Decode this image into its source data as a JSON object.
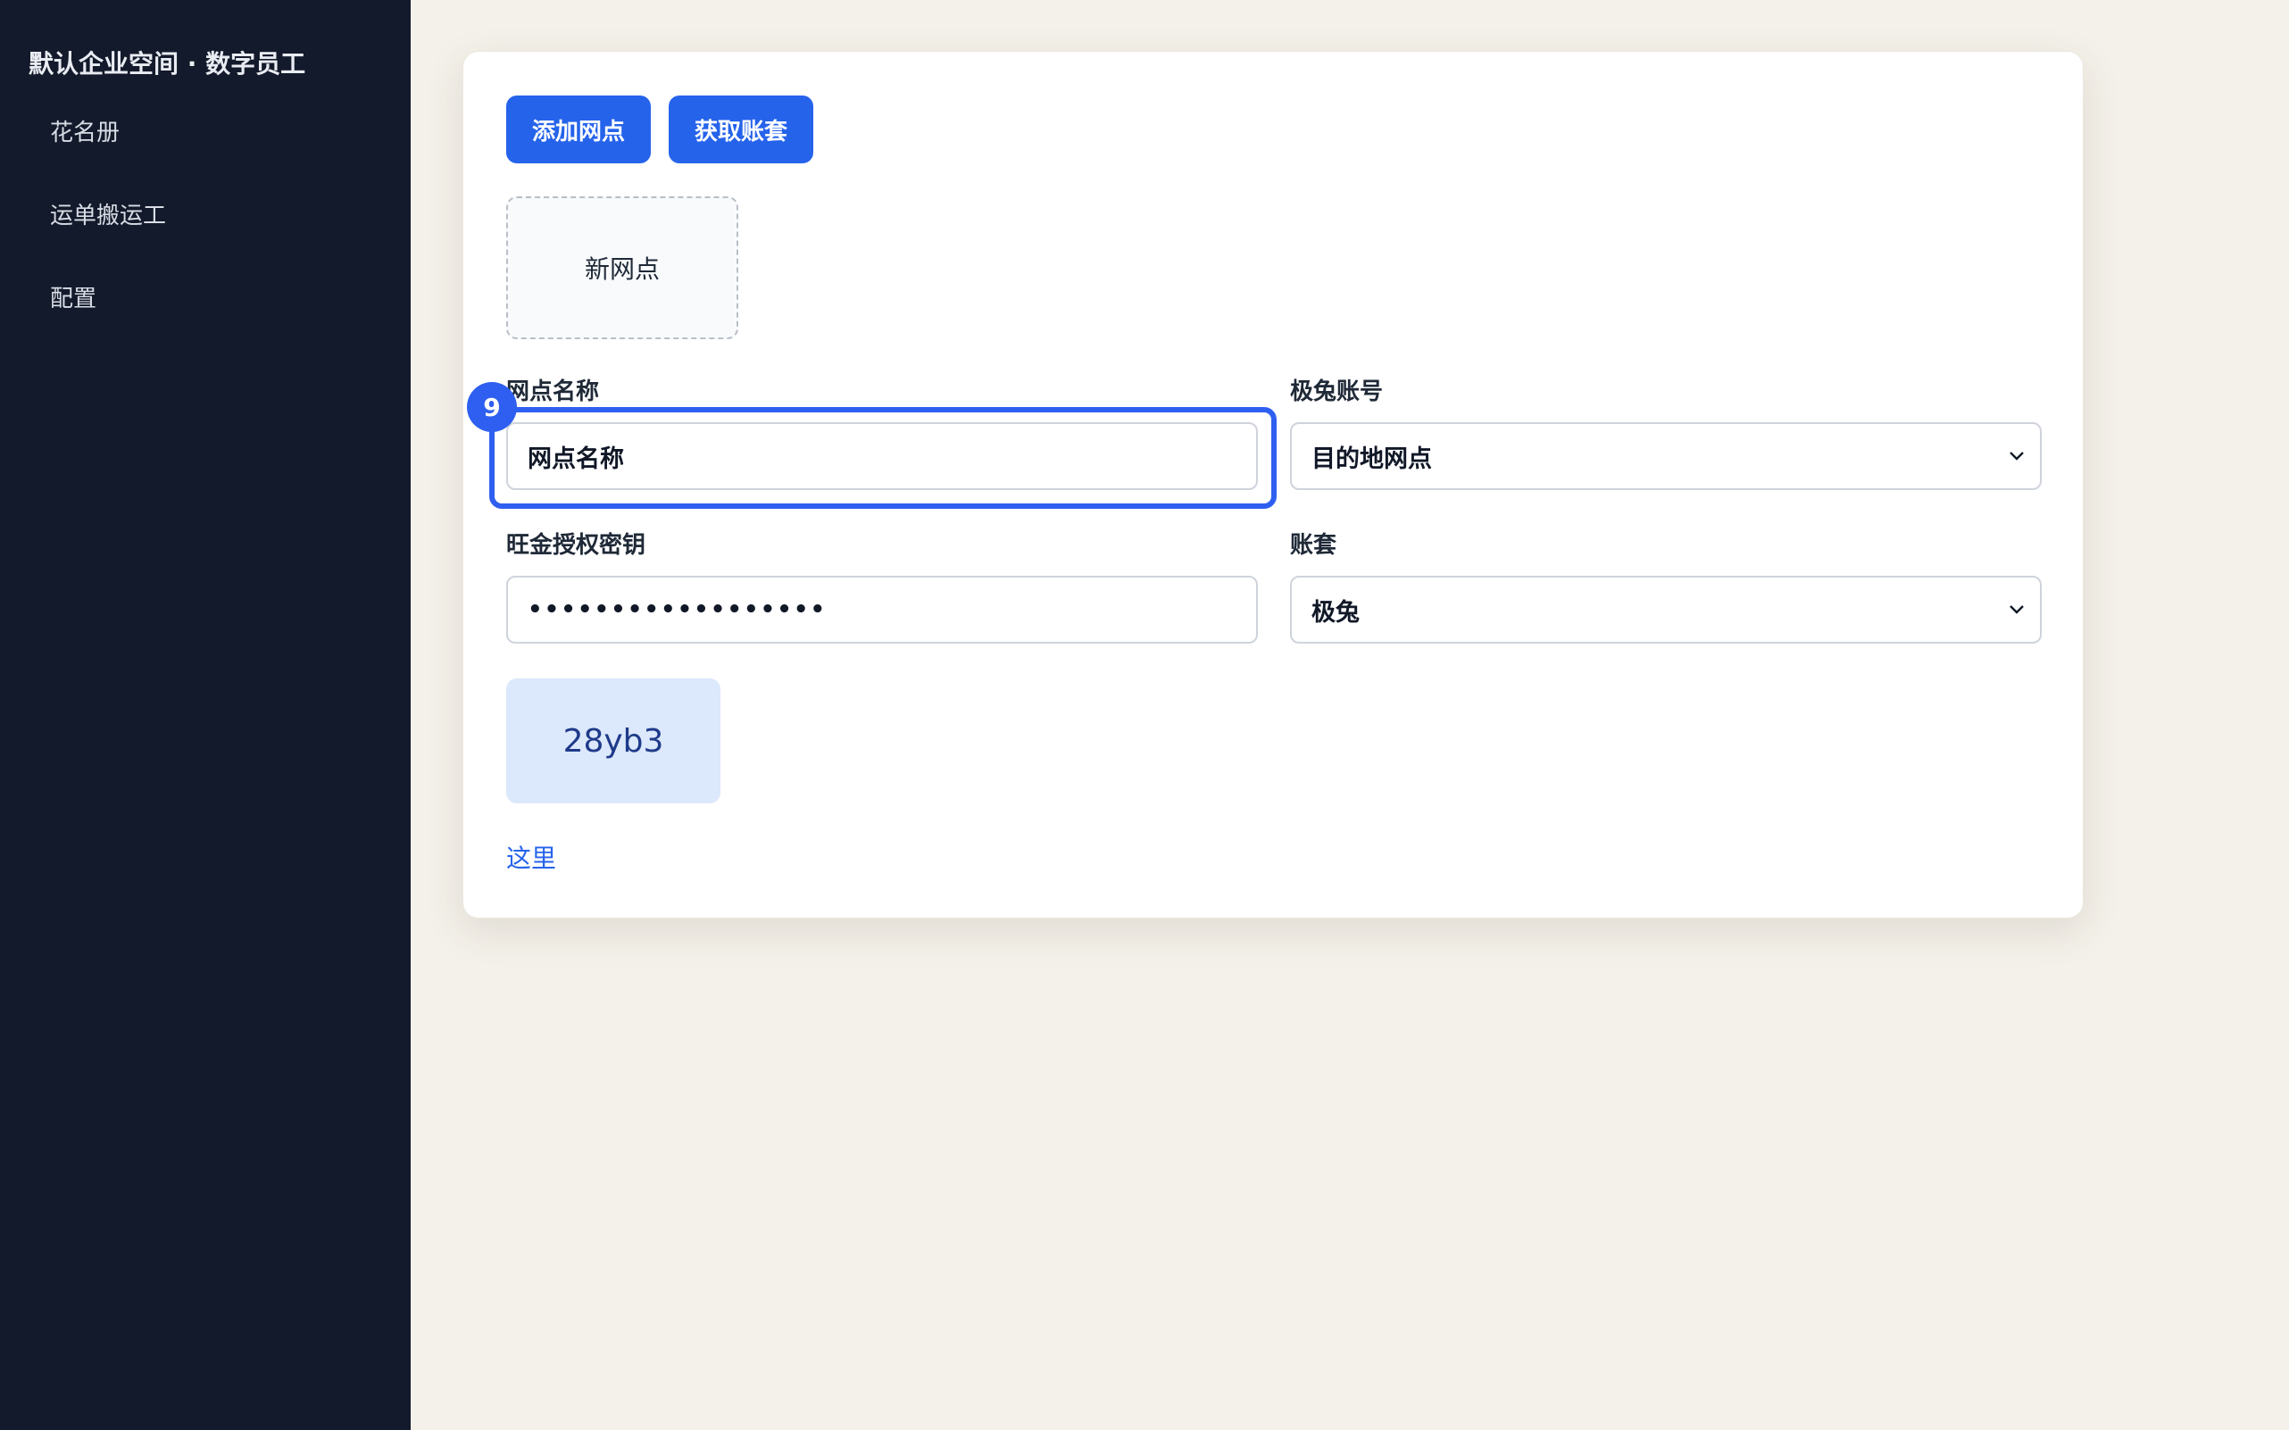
{
  "sidebar": {
    "brand": "默认企业空间 · 数字员工",
    "items": [
      {
        "label": "花名册"
      },
      {
        "label": "运单搬运工"
      },
      {
        "label": "配置"
      }
    ]
  },
  "toolbar": {
    "add_button": "添加网点",
    "fetch_button": "获取账套"
  },
  "tile": {
    "label": "新网点"
  },
  "form": {
    "name_label": "网点名称",
    "name_value": "网点名称",
    "account_label": "极兔账号",
    "account_value": "目的地网点",
    "key_label": "旺金授权密钥",
    "key_value": "••••••••••••••••••",
    "ledger_label": "账套",
    "ledger_value": "极兔"
  },
  "focus_badge": "9",
  "code": "28yb3",
  "link": "这里",
  "colors": {
    "sidebar": "#131a2b",
    "accent": "#2563eb",
    "background": "#f4f1ea"
  }
}
